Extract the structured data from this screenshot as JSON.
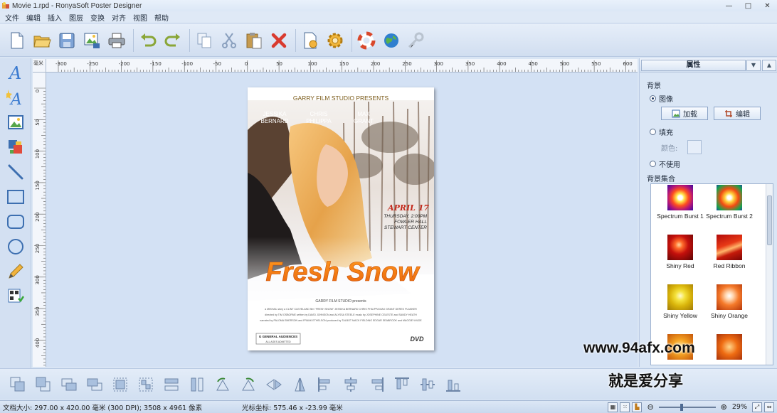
{
  "window": {
    "title": "Movie 1.rpd - RonyaSoft Poster Designer",
    "minimize": "—",
    "maximize": "□",
    "close": "✕"
  },
  "menu": [
    "文件",
    "编辑",
    "插入",
    "图层",
    "变换",
    "对齐",
    "视图",
    "帮助"
  ],
  "toolbar": {
    "items": [
      "new-icon",
      "open-icon",
      "save-icon",
      "export-image-icon",
      "print-icon",
      "undo-icon",
      "redo-icon",
      "copy-icon",
      "cut-icon",
      "paste-icon",
      "delete-icon",
      "page-settings-icon",
      "settings-gear-icon",
      "help-lifebuoy-icon",
      "web-globe-icon",
      "key-icon"
    ]
  },
  "left_tools": [
    "text-icon",
    "art-text-icon",
    "image-icon",
    "clipart-icon",
    "line-icon",
    "rectangle-icon",
    "rounded-rectangle-icon",
    "ellipse-icon",
    "pencil-icon",
    "qr-code-icon"
  ],
  "rulers": {
    "unit": "毫米",
    "h_ticks": [
      "-300",
      "-250",
      "-200",
      "-150",
      "-100",
      "-50",
      "0",
      "50",
      "100",
      "150",
      "200",
      "250",
      "300",
      "350",
      "400",
      "450",
      "500",
      "550",
      "600"
    ],
    "v_ticks": [
      "0",
      "50",
      "100",
      "150",
      "200",
      "250",
      "300",
      "350",
      "400"
    ]
  },
  "poster": {
    "studio": "GARRY FILM STUDIO PRESENTS",
    "cast": [
      "JESSIKA\nBERNARD",
      "CHRIS\nPHILIPPA",
      "MAX\nGRANT"
    ],
    "date": "APRIL 17",
    "event": [
      "THURSDAY, 2:00PM",
      "FOWLER HALL",
      "STEWART CENTER"
    ],
    "title": "Fresh Snow",
    "credits_head": "GARRY FILM STUDIO presents",
    "credits": [
      "a MIKHAIL story  a CLINT CLEVELAND film  \"FRESH SNOW\"  JESSIKA BERNARD  CHRIS PHILIPPA  MAX GRANT  DEREK PLANKER",
      "directed by TIM OSBORNE  written by DAVID JOHNSON and ALYSSA STEELE  music by JOSEPHINE CELESTE  and SANDY HEATH",
      "narrated by PALOMA EMERSON and FRANK ETHELSON  produced by TALBOT MACK FIELDING EDGAR SEABROOK and MAGGIE WILDE"
    ],
    "rating": "G  GENERAL AUDIENCES",
    "rating_sub": "ALL AGES ADMITTED",
    "dvd": "DVD"
  },
  "panel": {
    "title": "属性",
    "bg_label": "背景",
    "opt_image": "图像",
    "btn_load": "加载",
    "btn_edit": "编辑",
    "opt_fill": "填充",
    "color_label": "颜色:",
    "opt_none": "不使用",
    "collection_label": "背景集合",
    "gallery": [
      {
        "name": "Spectrum Burst 1"
      },
      {
        "name": "Spectrum Burst 2"
      },
      {
        "name": "Shiny Red"
      },
      {
        "name": "Red Ribbon"
      },
      {
        "name": "Shiny Yellow"
      },
      {
        "name": "Shiny Orange"
      }
    ]
  },
  "bottom_tools": [
    "bring-front-icon",
    "send-back-icon",
    "bring-forward-icon",
    "send-backward-icon",
    "group-icon",
    "ungroup-icon",
    "same-width-icon",
    "same-height-icon",
    "rotate-left-icon",
    "rotate-right-icon",
    "flip-horizontal-icon",
    "flip-vertical-icon",
    "align-left-icon",
    "align-center-icon",
    "align-right-icon",
    "align-top-icon",
    "align-middle-icon",
    "align-bottom-icon"
  ],
  "status": {
    "doc_size": "文档大小: 297.00 x 420.00 毫米 (300 DPI); 3508 x 4961 像素",
    "cursor": "光标坐标: 575.46 x -23.99 毫米",
    "zoom": "29%"
  },
  "watermark": {
    "line1": "www.94afx.com",
    "line2": "就是爱分享"
  }
}
